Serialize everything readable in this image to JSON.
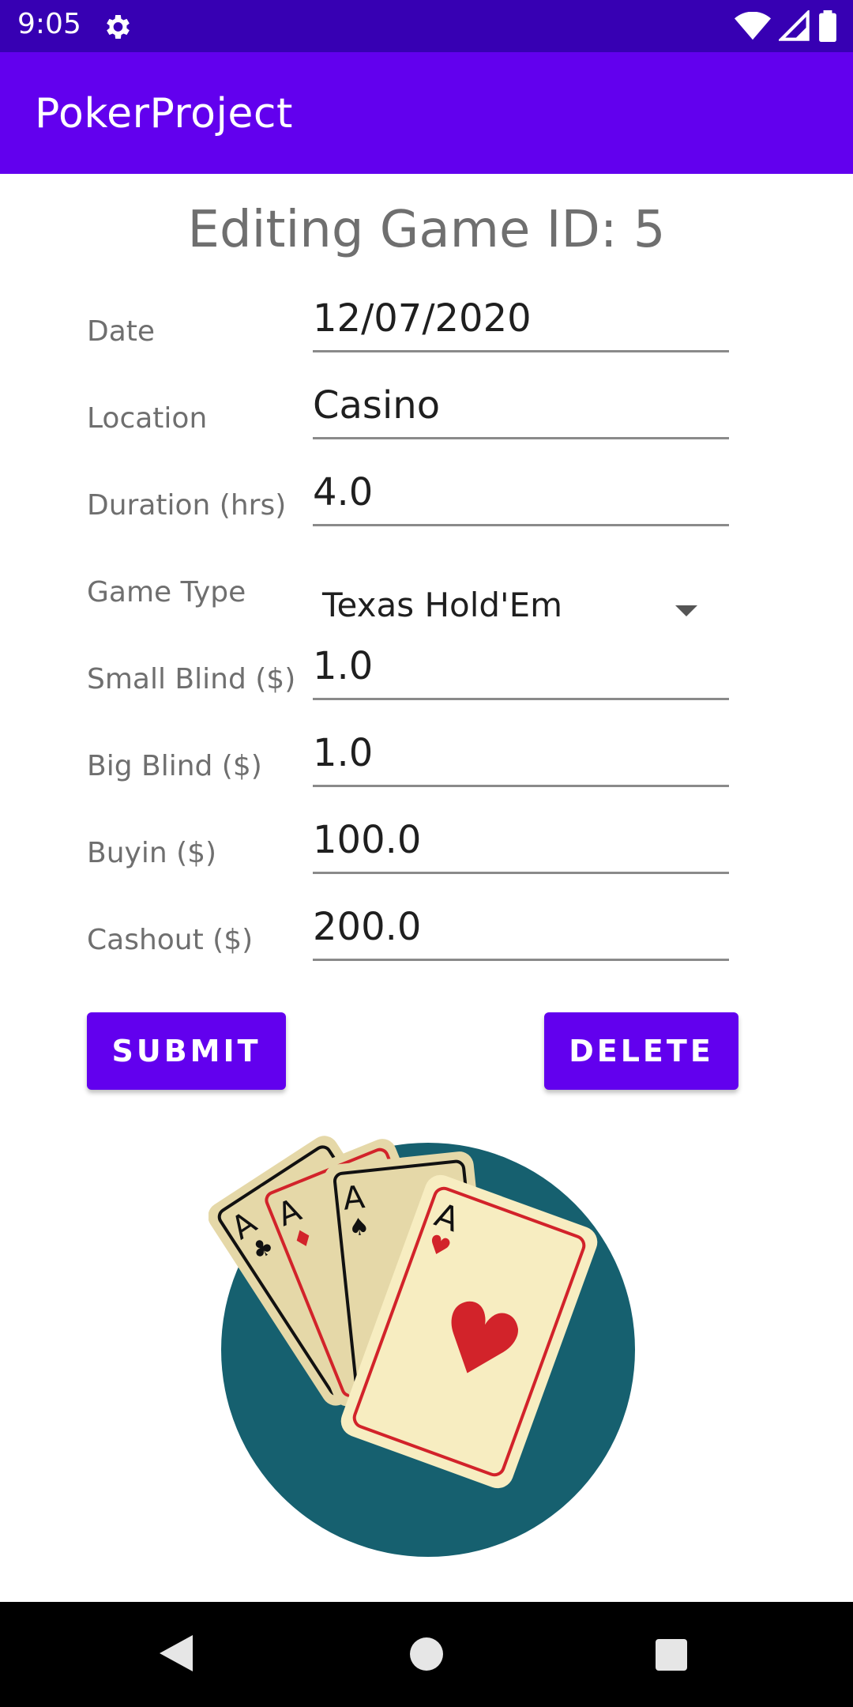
{
  "status_bar": {
    "time": "9:05",
    "icons": [
      "settings-gear-icon",
      "wifi-icon",
      "signal-icon",
      "battery-icon"
    ]
  },
  "app_bar": {
    "title": "PokerProject"
  },
  "page": {
    "heading": "Editing Game ID: 5"
  },
  "form": {
    "date": {
      "label": "Date",
      "value": "12/07/2020"
    },
    "location": {
      "label": "Location",
      "value": "Casino"
    },
    "duration": {
      "label": "Duration (hrs)",
      "value": "4.0"
    },
    "game_type": {
      "label": "Game Type",
      "value": "Texas Hold'Em"
    },
    "small_blind": {
      "label": "Small Blind ($)",
      "value": "1.0"
    },
    "big_blind": {
      "label": "Big Blind ($)",
      "value": "1.0"
    },
    "buyin": {
      "label": "Buyin ($)",
      "value": "100.0"
    },
    "cashout": {
      "label": "Cashout ($)",
      "value": "200.0"
    }
  },
  "buttons": {
    "submit": "SUBMIT",
    "delete": "DELETE"
  },
  "illustration": {
    "card_rank": "A",
    "colors": {
      "circle": "#16606F",
      "card_face": "#F7EDC1",
      "card_shade": "#E5D8A8",
      "red": "#D2232A"
    }
  },
  "colors": {
    "status_bar": "#3700B3",
    "primary": "#6200EE"
  },
  "nav_bar": {
    "icons": [
      "back-icon",
      "home-icon",
      "recents-icon"
    ]
  }
}
